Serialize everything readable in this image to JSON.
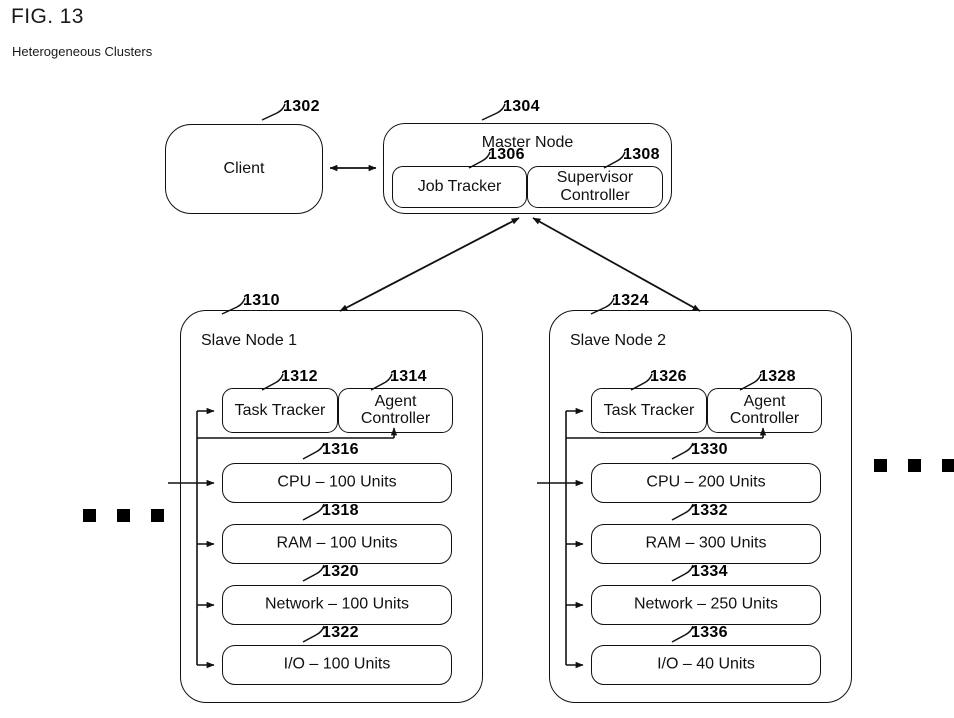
{
  "figure": {
    "title": "FIG. 13",
    "subtitle": "Heterogeneous Clusters"
  },
  "client": {
    "label": "Client",
    "ref": "1302"
  },
  "master_node": {
    "label": "Master Node",
    "ref": "1304",
    "components": [
      {
        "label": "Job Tracker",
        "ref": "1306"
      },
      {
        "label_line1": "Supervisor",
        "label_line2": "Controller",
        "ref": "1308"
      }
    ]
  },
  "slave_nodes": [
    {
      "label": "Slave Node 1",
      "ref": "1310",
      "task_tracker": {
        "label": "Task Tracker",
        "ref": "1312"
      },
      "agent_controller": {
        "label_line1": "Agent",
        "label_line2": "Controller",
        "ref": "1314"
      },
      "resources": [
        {
          "label": "CPU – 100 Units",
          "ref": "1316"
        },
        {
          "label": "RAM – 100 Units",
          "ref": "1318"
        },
        {
          "label": "Network – 100 Units",
          "ref": "1320"
        },
        {
          "label": "I/O – 100 Units",
          "ref": "1322"
        }
      ]
    },
    {
      "label": "Slave Node 2",
      "ref": "1324",
      "task_tracker": {
        "label": "Task Tracker",
        "ref": "1326"
      },
      "agent_controller": {
        "label_line1": "Agent",
        "label_line2": "Controller",
        "ref": "1328"
      },
      "resources": [
        {
          "label": "CPU – 200 Units",
          "ref": "1330"
        },
        {
          "label": "RAM – 300 Units",
          "ref": "1332"
        },
        {
          "label": "Network – 250 Units",
          "ref": "1334"
        },
        {
          "label": "I/O – 40 Units",
          "ref": "1336"
        }
      ]
    }
  ],
  "ellipses": {
    "left": "■ ■ ■",
    "right": "■ ■ ■"
  },
  "colors": {
    "stroke": "#111111",
    "background": "#ffffff",
    "text": "#111111"
  }
}
